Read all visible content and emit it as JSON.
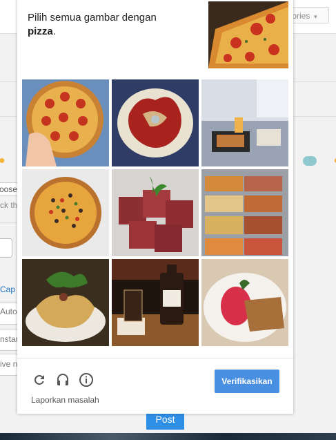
{
  "background": {
    "categories_label": "egories",
    "snippets": [
      "oose",
      "ck th",
      "Cap",
      "Autor",
      "nstan",
      "ive n"
    ],
    "post_label": "Post"
  },
  "captcha": {
    "instruction_text": "Pilih semua gambar dengan",
    "target_word": "pizza",
    "target_suffix": ".",
    "tiles": [
      {
        "subject": "pizza",
        "row": 1,
        "col": 1
      },
      {
        "subject": "red-meat-dish",
        "row": 1,
        "col": 2
      },
      {
        "subject": "restaurant-table-food",
        "row": 1,
        "col": 3
      },
      {
        "subject": "pizza",
        "row": 2,
        "col": 1
      },
      {
        "subject": "raw-beef-cubes",
        "row": 2,
        "col": 2
      },
      {
        "subject": "buffet-trays",
        "row": 2,
        "col": 3
      },
      {
        "subject": "plated-appetizer",
        "row": 3,
        "col": 1
      },
      {
        "subject": "whiskey-bottle-glass",
        "row": 3,
        "col": 2
      },
      {
        "subject": "dessert-plate",
        "row": 3,
        "col": 3
      }
    ],
    "footer": {
      "icons": [
        "reload-icon",
        "audio-icon",
        "info-icon"
      ],
      "report_label": "Laporkan masalah",
      "verify_label": "Verifikasikan"
    },
    "colors": {
      "accent": "#4a90e2"
    }
  }
}
